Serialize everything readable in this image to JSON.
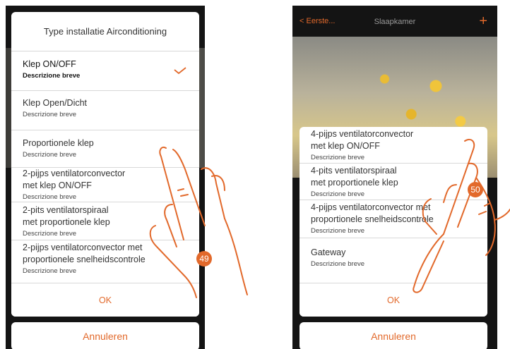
{
  "left": {
    "dialog_title": "Type installatie Airconditioning",
    "options": [
      {
        "name": "Klep ON/OFF",
        "desc": "Descrizione breve",
        "selected": true
      },
      {
        "name": "Klep Open/Dicht",
        "desc": "Descrizione breve"
      },
      {
        "name": "Proportionele klep",
        "desc": "Descrizione breve"
      },
      {
        "name": "2-pijps ventilatorconvector\nmet klep ON/OFF",
        "desc": "Descrizione breve"
      },
      {
        "name": "2-pits ventilatorspiraal\nmet proportionele klep",
        "desc": "Descrizione breve"
      },
      {
        "name": "2-pijps ventilatorconvector met\nproportionele snelheidscontrole",
        "desc": "Descrizione breve"
      }
    ],
    "ok_label": "OK",
    "cancel_label": "Annuleren",
    "step_badge": "49"
  },
  "right": {
    "back_label": "Eerste...",
    "title": "Slaapkamer",
    "plus_label": "+",
    "options": [
      {
        "name": "4-pijps ventilatorconvector\nmet klep ON/OFF",
        "desc": "Descrizione breve"
      },
      {
        "name": "4-pits ventilatorspiraal\nmet proportionele klep",
        "desc": "Descrizione breve"
      },
      {
        "name": "4-pijps ventilatorconvector met\nproportionele snelheidscontrole",
        "desc": "Descrizione breve"
      },
      {
        "name": "Gateway",
        "desc": "Descrizione breve"
      }
    ],
    "ok_label": "OK",
    "cancel_label": "Annuleren",
    "step_badge": "50"
  },
  "colors": {
    "accent": "#e2692b",
    "divider": "#d8d8d8"
  },
  "icons": {
    "selected": "checkmark-icon",
    "back": "chevron-left-icon",
    "gesture": "tap-hand-icon"
  }
}
